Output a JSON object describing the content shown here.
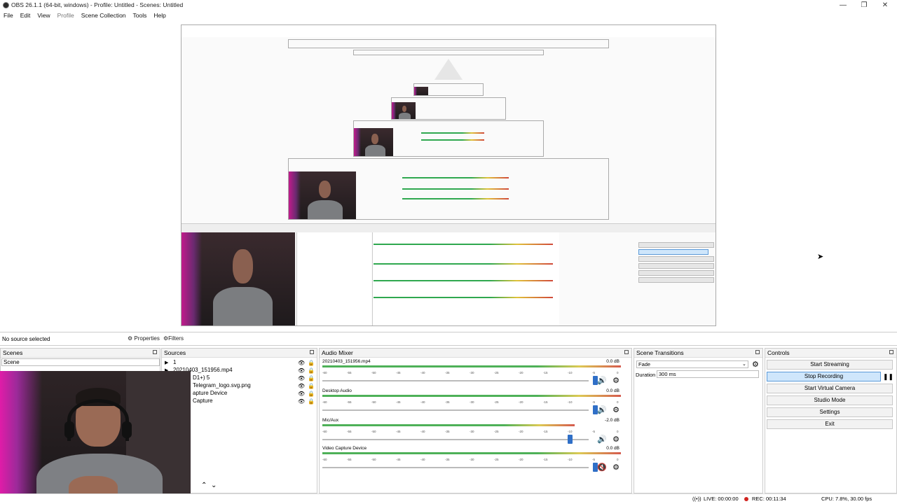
{
  "window": {
    "title": "OBS 26.1.1 (64-bit, windows) - Profile: Untitled - Scenes: Untitled",
    "minimize": "—",
    "maximize": "❐",
    "close": "✕"
  },
  "menu": [
    "File",
    "Edit",
    "View",
    "Profile",
    "Scene Collection",
    "Tools",
    "Help"
  ],
  "toolbar": {
    "no_source": "No source selected",
    "properties": "Properties",
    "filters": "Filters"
  },
  "scenes": {
    "title": "Scenes",
    "items": [
      "Scene"
    ]
  },
  "sources": {
    "title": "Sources",
    "items": [
      {
        "label": "1"
      },
      {
        "label": "20210403_151956.mp4"
      },
      {
        "label": "D1+) 5"
      },
      {
        "label": "Telegram_logo.svg.png"
      },
      {
        "label": "apture Device"
      },
      {
        "label": "Capture"
      }
    ]
  },
  "audio_mixer": {
    "title": "Audio Mixer",
    "ticks": [
      "-60",
      "-55",
      "-50",
      "-45",
      "-40",
      "-35",
      "-30",
      "-25",
      "-20",
      "-15",
      "-10",
      "-5",
      "0"
    ],
    "channels": [
      {
        "name": "20210403_151956.mp4",
        "db": "0.0 dB",
        "level": 0.84,
        "muted": false
      },
      {
        "name": "Desktop Audio",
        "db": "0.0 dB",
        "level": 0.84,
        "muted": false
      },
      {
        "name": "Mic/Aux",
        "db": "-2.0 dB",
        "level": 0.76,
        "muted": false
      },
      {
        "name": "Video Capture Device",
        "db": "0.0 dB",
        "level": 0.84,
        "muted": true
      }
    ]
  },
  "transitions": {
    "title": "Scene Transitions",
    "selected": "Fade",
    "duration_label": "Duration",
    "duration_value": "300 ms"
  },
  "controls": {
    "title": "Controls",
    "buttons": [
      "Start Streaming",
      "Stop Recording",
      "Start Virtual Camera",
      "Studio Mode",
      "Settings",
      "Exit"
    ]
  },
  "status": {
    "live": "LIVE: 00:00:00",
    "rec": "REC: 00:11:34",
    "cpu": "CPU: 7.8%, 30.00 fps"
  }
}
